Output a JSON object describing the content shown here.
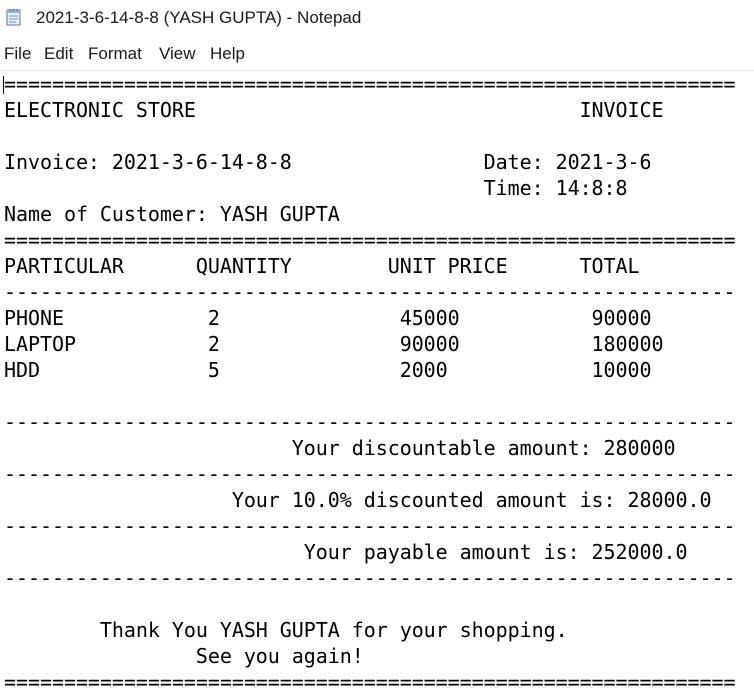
{
  "window": {
    "title": "2021-3-6-14-8-8 (YASH GUPTA) - Notepad"
  },
  "menu": {
    "items": [
      "File",
      "Edit",
      "Format",
      "View",
      "Help"
    ]
  },
  "document": {
    "lines": [
      "=============================================================",
      "ELECTRONIC STORE                                INVOICE",
      "",
      "Invoice: 2021-3-6-14-8-8                Date: 2021-3-6",
      "                                        Time: 14:8:8",
      "Name of Customer: YASH GUPTA",
      "=============================================================",
      "PARTICULAR      QUANTITY        UNIT PRICE      TOTAL",
      "-------------------------------------------------------------",
      "PHONE            2               45000           90000",
      "LAPTOP           2               90000           180000",
      "HDD              5               2000            10000",
      "",
      "-------------------------------------------------------------",
      "                        Your discountable amount: 280000",
      "-------------------------------------------------------------",
      "                   Your 10.0% discounted amount is: 28000.0",
      "-------------------------------------------------------------",
      "                         Your payable amount is: 252000.0",
      "-------------------------------------------------------------",
      "",
      "        Thank You YASH GUPTA for your shopping.",
      "                See you again!",
      "============================================================="
    ]
  }
}
